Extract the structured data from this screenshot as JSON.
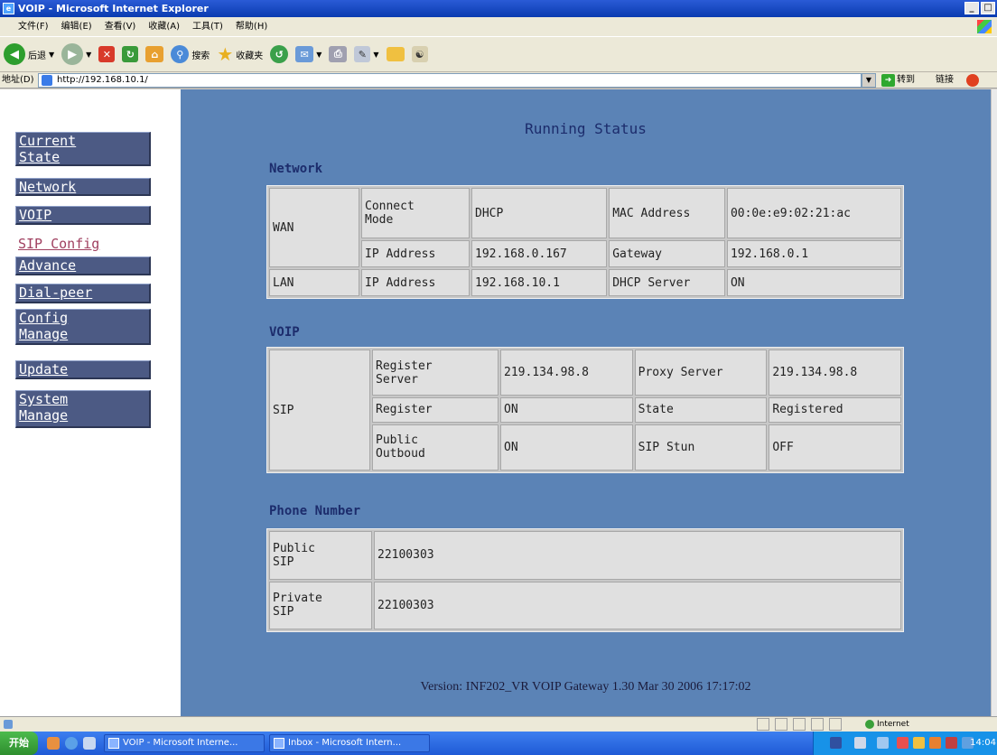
{
  "window": {
    "title": "VOIP - Microsoft Internet Explorer"
  },
  "menu": [
    "文件(F)",
    "编辑(E)",
    "查看(V)",
    "收藏(A)",
    "工具(T)",
    "帮助(H)"
  ],
  "toolbar": {
    "back": "后退",
    "search": "搜索",
    "favorites": "收藏夹"
  },
  "address": {
    "label": "地址(D)",
    "url": "http://192.168.10.1/",
    "go": "转到",
    "links": "链接"
  },
  "nav": {
    "current_state": [
      "Current",
      "State"
    ],
    "network": "Network",
    "voip": "VOIP",
    "sip_config": "SIP Config",
    "advance": "Advance",
    "dial_peer": "Dial-peer",
    "config_manage": [
      "Config",
      "Manage"
    ],
    "update": "Update",
    "system_manage": [
      "System",
      "Manage"
    ]
  },
  "page": {
    "title": "Running Status",
    "network_heading": "Network",
    "voip_heading": "VOIP",
    "phone_heading": "Phone Number",
    "version": "Version: INF202_VR VOIP Gateway 1.30 Mar 30 2006 17:17:02"
  },
  "network": {
    "wan": "WAN",
    "connect_mode_label": [
      "Connect",
      "Mode"
    ],
    "connect_mode": "DHCP",
    "mac_label": "MAC Address",
    "mac": "00:0e:e9:02:21:ac",
    "ip_label": "IP Address",
    "wan_ip": "192.168.0.167",
    "gateway_label": "Gateway",
    "gateway": "192.168.0.1",
    "lan": "LAN",
    "lan_ip_label": "IP Address",
    "lan_ip": "192.168.10.1",
    "dhcp_server_label": "DHCP Server",
    "dhcp_server": "ON"
  },
  "voip": {
    "sip": "SIP",
    "register_server_label": [
      "Register",
      "Server"
    ],
    "register_server": "219.134.98.8",
    "proxy_server_label": "Proxy Server",
    "proxy_server": "219.134.98.8",
    "register_label": "Register",
    "register": "ON",
    "state_label": "State",
    "state": "Registered",
    "public_outboud_label": [
      "Public",
      "Outboud"
    ],
    "public_outboud": "ON",
    "sip_stun_label": "SIP Stun",
    "sip_stun": "OFF"
  },
  "phone": {
    "public_label": [
      "Public",
      "SIP"
    ],
    "public": "22100303",
    "private_label": [
      "Private",
      "SIP"
    ],
    "private": "22100303"
  },
  "status": {
    "zone": "Internet"
  },
  "taskbar": {
    "start": "开始",
    "items": [
      "VOIP - Microsoft Interne...",
      "Inbox - Microsoft Intern..."
    ],
    "clock": "14:04"
  },
  "colors": {
    "content_bg": "#5b83b6",
    "nav_button": "#4c5a84",
    "heading": "#1c2c6c"
  }
}
